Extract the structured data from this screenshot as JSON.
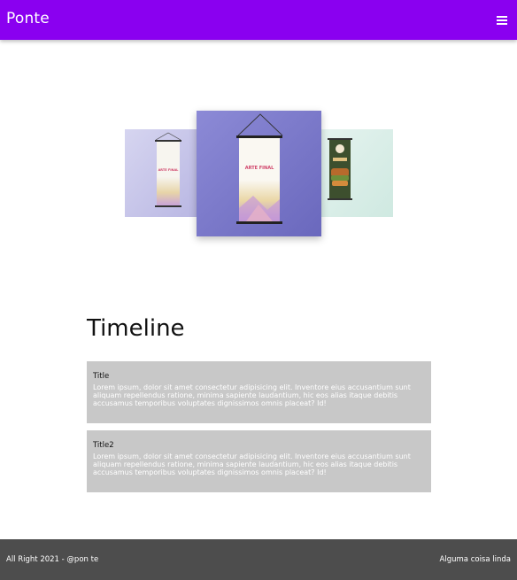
{
  "navbar": {
    "brand": "Ponte",
    "menu_icon": "hamburger-menu-icon",
    "background_color": "#8a00f0"
  },
  "carousel": {
    "slides": [
      {
        "label": "ARTE FINAL",
        "background_color": "#c9c8ea"
      },
      {
        "label": "ARTE FINAL",
        "background_color": "#7e7cca"
      },
      {
        "label": "",
        "background_color": "#d9eee8"
      }
    ]
  },
  "timeline": {
    "title": "Timeline",
    "items": [
      {
        "title": "Title",
        "text": "Lorem ipsum, dolor sit amet consectetur adipisicing elit. Inventore eius accusantium sunt aliquam repellendus ratione, minima sapiente laudantium, hic eos alias itaque debitis accusamus temporibus voluptates dignissimos omnis placeat? Id!"
      },
      {
        "title": "Title2",
        "text": "Lorem ipsum, dolor sit amet consectetur adipisicing elit. Inventore eius accusantium sunt aliquam repellendus ratione, minima sapiente laudantium, hic eos alias itaque debitis accusamus temporibus voluptates dignissimos omnis placeat? Id!"
      }
    ],
    "card_color": "#c8c8c8"
  },
  "footer": {
    "left": "All Right 2021 - @pon te",
    "right": "Alguma coisa linda",
    "background_color": "#4d4d4d"
  }
}
